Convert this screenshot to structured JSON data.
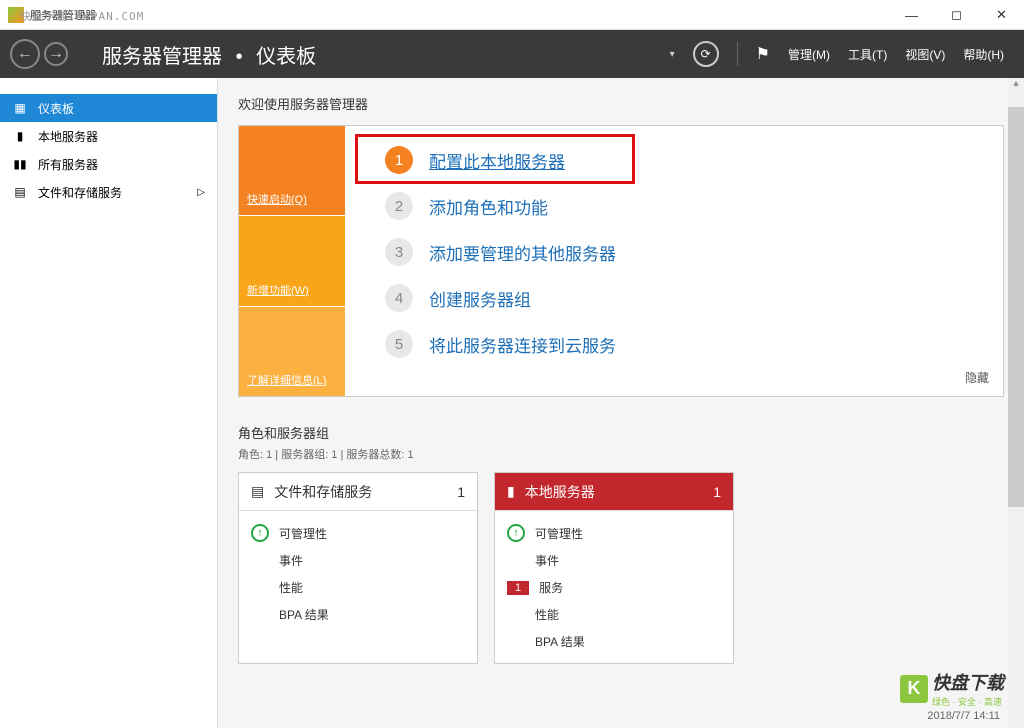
{
  "titlebar": {
    "title": "服务器管理器",
    "watermark": "快盘下载 KKPAN.COM"
  },
  "header": {
    "breadcrumb_app": "服务器管理器",
    "breadcrumb_page": "仪表板",
    "menu": {
      "manage": "管理(M)",
      "tools": "工具(T)",
      "view": "视图(V)",
      "help": "帮助(H)"
    }
  },
  "sidebar": {
    "items": [
      {
        "label": "仪表板",
        "active": true
      },
      {
        "label": "本地服务器",
        "active": false
      },
      {
        "label": "所有服务器",
        "active": false
      },
      {
        "label": "文件和存储服务",
        "active": false,
        "expandable": true
      }
    ]
  },
  "welcome": {
    "title": "欢迎使用服务器管理器",
    "tabs": {
      "quick": "快速启动(Q)",
      "new": "新增功能(W)",
      "learn": "了解详细信息(L)"
    },
    "steps": [
      {
        "num": "1",
        "text": "配置此本地服务器",
        "primary": true
      },
      {
        "num": "2",
        "text": "添加角色和功能",
        "primary": false
      },
      {
        "num": "3",
        "text": "添加要管理的其他服务器",
        "primary": false
      },
      {
        "num": "4",
        "text": "创建服务器组",
        "primary": false
      },
      {
        "num": "5",
        "text": "将此服务器连接到云服务",
        "primary": false
      }
    ],
    "hide": "隐藏"
  },
  "roles": {
    "title": "角色和服务器组",
    "sub": "角色: 1 | 服务器组: 1 | 服务器总数: 1",
    "tiles": [
      {
        "header": "文件和存储服务",
        "count": "1",
        "style": "white",
        "rows": [
          {
            "icon": "up",
            "text": "可管理性"
          },
          {
            "text": "事件"
          },
          {
            "text": "性能"
          },
          {
            "text": "BPA 结果"
          }
        ]
      },
      {
        "header": "本地服务器",
        "count": "1",
        "style": "red",
        "rows": [
          {
            "icon": "up",
            "text": "可管理性"
          },
          {
            "text": "事件"
          },
          {
            "badge": "1",
            "text": "服务"
          },
          {
            "text": "性能"
          },
          {
            "text": "BPA 结果"
          }
        ]
      }
    ]
  },
  "timestamp": "2018/7/7 14:11",
  "watermark_logo": {
    "main": "快盘下载",
    "sub": "绿色 · 安全 · 高速"
  }
}
